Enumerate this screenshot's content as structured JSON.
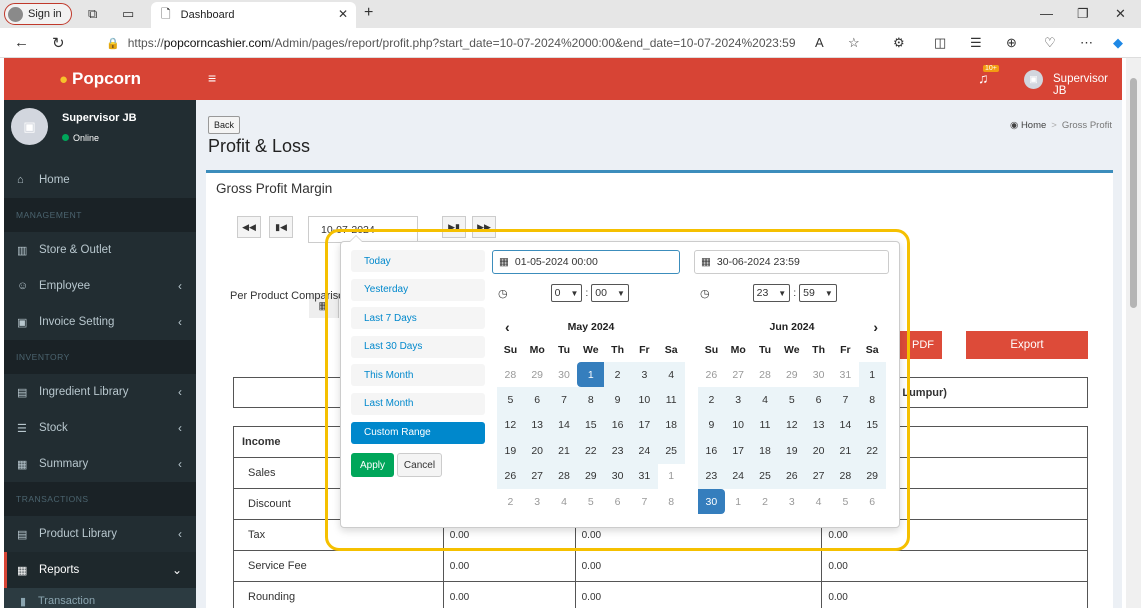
{
  "browser": {
    "signin_label": "Sign in",
    "tab_title": "Dashboard",
    "url_prefix": "https://",
    "url_host": "popcorncashier.com",
    "url_path": "/Admin/pages/report/profit.php?start_date=10-07-2024%2000:00&end_date=10-07-2024%2023:59"
  },
  "sidebar": {
    "logo": "Popcorn",
    "user_name": "Supervisor JB",
    "user_status": "Online",
    "items": [
      {
        "type": "item",
        "label": "Home",
        "icon": "home-icon",
        "glyph": "⌂"
      },
      {
        "type": "header",
        "label": "MANAGEMENT"
      },
      {
        "type": "item",
        "label": "Store & Outlet",
        "icon": "bank-icon",
        "glyph": "▥"
      },
      {
        "type": "item",
        "label": "Employee",
        "icon": "users-icon",
        "glyph": "☺",
        "chevron": "‹"
      },
      {
        "type": "item",
        "label": "Invoice Setting",
        "icon": "money-icon",
        "glyph": "▣",
        "chevron": "‹"
      },
      {
        "type": "header",
        "label": "INVENTORY"
      },
      {
        "type": "item",
        "label": "Ingredient Library",
        "icon": "book-icon",
        "glyph": "▤",
        "chevron": "‹"
      },
      {
        "type": "item",
        "label": "Stock",
        "icon": "database-icon",
        "glyph": "☰",
        "chevron": "‹"
      },
      {
        "type": "item",
        "label": "Summary",
        "icon": "table-icon",
        "glyph": "▦",
        "chevron": "‹"
      },
      {
        "type": "header",
        "label": "TRANSACTIONS"
      },
      {
        "type": "item",
        "label": "Product Library",
        "icon": "book-icon",
        "glyph": "▤",
        "chevron": "‹"
      },
      {
        "type": "active",
        "label": "Reports",
        "icon": "table-icon",
        "glyph": "▦",
        "chevron": "⌄"
      },
      {
        "type": "sub",
        "label": "Transaction",
        "icon": "bar-chart-icon",
        "glyph": "▮"
      }
    ]
  },
  "topbar": {
    "notif_count": "10+",
    "user_name": "Supervisor JB"
  },
  "page": {
    "back_label": "Back",
    "title": "Profit & Loss",
    "breadcrumb_home": "Home",
    "breadcrumb_current": "Gross Profit",
    "box_title": "Gross Profit Margin",
    "date_value": "10-07-2024",
    "per_product_label": "Per Product Comparisc",
    "pdf_label": "PDF",
    "export_label": "Export",
    "info_text": "ala Lumpur)"
  },
  "table": {
    "header": "Income",
    "rows": [
      {
        "label": "Sales",
        "c1": "",
        "c2": "",
        "c3": ""
      },
      {
        "label": "Discount",
        "c1": "",
        "c2": "",
        "c3": ""
      },
      {
        "label": "Tax",
        "c1": "0.00",
        "c2": "0.00",
        "c3": "0.00"
      },
      {
        "label": "Service Fee",
        "c1": "0.00",
        "c2": "0.00",
        "c3": "0.00"
      },
      {
        "label": "Rounding",
        "c1": "0.00",
        "c2": "0.00",
        "c3": "0.00"
      }
    ]
  },
  "daterangepicker": {
    "ranges": [
      "Today",
      "Yesterday",
      "Last 7 Days",
      "Last 30 Days",
      "This Month",
      "Last Month",
      "Custom Range"
    ],
    "active_range": "Custom Range",
    "apply_label": "Apply",
    "cancel_label": "Cancel",
    "start_input": "01-05-2024 00:00",
    "end_input": "30-06-2024 23:59",
    "start_hour": "0",
    "start_minute": "00",
    "end_hour": "23",
    "end_minute": "59",
    "dow": [
      "Su",
      "Mo",
      "Tu",
      "We",
      "Th",
      "Fr",
      "Sa"
    ],
    "left_month": "May 2024",
    "right_month": "Jun 2024",
    "left_days": [
      [
        28,
        "off"
      ],
      [
        29,
        "off"
      ],
      [
        30,
        "off"
      ],
      [
        1,
        "start"
      ],
      [
        2,
        "in"
      ],
      [
        3,
        "in"
      ],
      [
        4,
        "in"
      ],
      [
        5,
        "in"
      ],
      [
        6,
        "in"
      ],
      [
        7,
        "in"
      ],
      [
        8,
        "in"
      ],
      [
        9,
        "in"
      ],
      [
        10,
        "in"
      ],
      [
        11,
        "in"
      ],
      [
        12,
        "in"
      ],
      [
        13,
        "in"
      ],
      [
        14,
        "in"
      ],
      [
        15,
        "in"
      ],
      [
        16,
        "in"
      ],
      [
        17,
        "in"
      ],
      [
        18,
        "in"
      ],
      [
        19,
        "in"
      ],
      [
        20,
        "in"
      ],
      [
        21,
        "in"
      ],
      [
        22,
        "in"
      ],
      [
        23,
        "in"
      ],
      [
        24,
        "in"
      ],
      [
        25,
        "in"
      ],
      [
        26,
        "in"
      ],
      [
        27,
        "in"
      ],
      [
        28,
        "in"
      ],
      [
        29,
        "in"
      ],
      [
        30,
        "in"
      ],
      [
        31,
        "in"
      ],
      [
        1,
        "off"
      ],
      [
        2,
        "off"
      ],
      [
        3,
        "off"
      ],
      [
        4,
        "off"
      ],
      [
        5,
        "off"
      ],
      [
        6,
        "off"
      ],
      [
        7,
        "off"
      ],
      [
        8,
        "off"
      ]
    ],
    "right_days": [
      [
        26,
        "off"
      ],
      [
        27,
        "off"
      ],
      [
        28,
        "off"
      ],
      [
        29,
        "off"
      ],
      [
        30,
        "off"
      ],
      [
        31,
        "off"
      ],
      [
        1,
        "in"
      ],
      [
        2,
        "in"
      ],
      [
        3,
        "in"
      ],
      [
        4,
        "in"
      ],
      [
        5,
        "in"
      ],
      [
        6,
        "in"
      ],
      [
        7,
        "in"
      ],
      [
        8,
        "in"
      ],
      [
        9,
        "in"
      ],
      [
        10,
        "in"
      ],
      [
        11,
        "in"
      ],
      [
        12,
        "in"
      ],
      [
        13,
        "in"
      ],
      [
        14,
        "in"
      ],
      [
        15,
        "in"
      ],
      [
        16,
        "in"
      ],
      [
        17,
        "in"
      ],
      [
        18,
        "in"
      ],
      [
        19,
        "in"
      ],
      [
        20,
        "in"
      ],
      [
        21,
        "in"
      ],
      [
        22,
        "in"
      ],
      [
        23,
        "in"
      ],
      [
        24,
        "in"
      ],
      [
        25,
        "in"
      ],
      [
        26,
        "in"
      ],
      [
        27,
        "in"
      ],
      [
        28,
        "in"
      ],
      [
        29,
        "in"
      ],
      [
        30,
        "end"
      ],
      [
        1,
        "off"
      ],
      [
        2,
        "off"
      ],
      [
        3,
        "off"
      ],
      [
        4,
        "off"
      ],
      [
        5,
        "off"
      ],
      [
        6,
        "off"
      ]
    ]
  },
  "colors": {
    "brand": "#d74435",
    "sidebar": "#222d32",
    "highlight": "#f5c000",
    "selected": "#357ebd"
  }
}
